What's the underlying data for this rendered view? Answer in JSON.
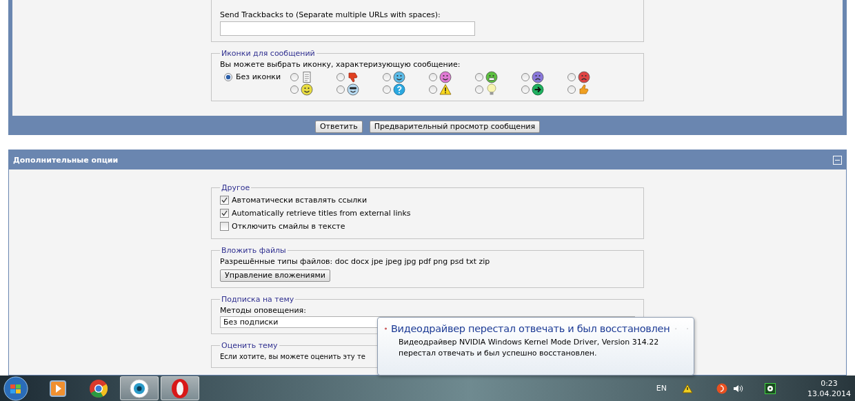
{
  "reply_panel": {
    "trackback": {
      "label": "Send Trackbacks to (Separate multiple URLs with spaces):"
    },
    "message_icons": {
      "legend": "Иконки для сообщений",
      "prompt": "Вы можете выбрать иконку, характеризующую сообщение:",
      "no_icon": {
        "label": "Без иконки",
        "selected": true
      },
      "icons": [
        {
          "kind": "document",
          "selected": false
        },
        {
          "kind": "thumbs-down",
          "selected": false
        },
        {
          "kind": "wink",
          "selected": false
        },
        {
          "kind": "pink-smile",
          "selected": false
        },
        {
          "kind": "grin",
          "selected": false
        },
        {
          "kind": "frown",
          "selected": false
        },
        {
          "kind": "angry",
          "selected": false
        },
        {
          "kind": "smile",
          "selected": false
        },
        {
          "kind": "cool",
          "selected": false
        },
        {
          "kind": "question",
          "selected": false
        },
        {
          "kind": "warning",
          "selected": false
        },
        {
          "kind": "lightbulb",
          "selected": false
        },
        {
          "kind": "arrow",
          "selected": false
        },
        {
          "kind": "thumbs-up",
          "selected": false
        }
      ]
    },
    "buttons": [
      "Ответить",
      "Предварительный просмотр сообщения"
    ]
  },
  "options_panel": {
    "title": "Дополнительные опции",
    "expanded": true,
    "other": {
      "legend": "Другое",
      "checkboxes": [
        {
          "label": "Автоматически вставлять ссылки",
          "checked": true
        },
        {
          "label": "Automatically retrieve titles from external links",
          "checked": true
        },
        {
          "label": "Отключить смайлы в тексте",
          "checked": false
        }
      ]
    },
    "attachments": {
      "legend": "Вложить файлы",
      "allowed": "Разрешённые типы файлов: doc docx jpe jpeg jpg pdf png psd txt zip",
      "button": "Управление вложениями"
    },
    "subscription": {
      "legend": "Подписка на тему",
      "label": "Методы оповещения:",
      "value": "Без подписки"
    },
    "rating": {
      "legend": "Оценить тему",
      "text": "Если хотите, вы можете оценить эту те"
    }
  },
  "notification": {
    "title": "Видеодрайвер перестал отвечать и был восстановлен",
    "message": "Видеодрайвер NVIDIA Windows Kernel Mode Driver, Version 314.22  перестал отвечать и был успешно восстановлен."
  },
  "taskbar": {
    "apps": [
      {
        "kind": "media-player",
        "active": false
      },
      {
        "kind": "chrome",
        "active": false
      },
      {
        "kind": "camera",
        "active": true
      },
      {
        "kind": "opera",
        "active": true
      }
    ],
    "tray": {
      "language": "EN",
      "time": "0:23",
      "date": "13.04.2014"
    }
  }
}
